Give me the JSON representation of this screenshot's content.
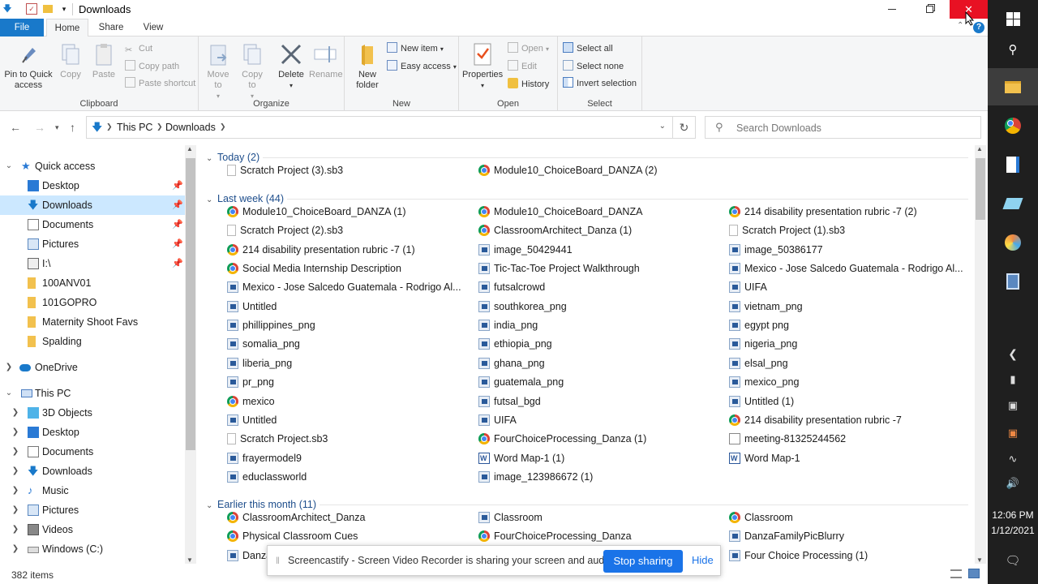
{
  "window": {
    "title": "Downloads",
    "help_label": "?"
  },
  "tabs": [
    "File",
    "Home",
    "Share",
    "View"
  ],
  "ribbon": {
    "clipboard": {
      "label": "Clipboard",
      "pin": "Pin to Quick access",
      "copy": "Copy",
      "paste": "Paste",
      "cut": "Cut",
      "copy_path": "Copy path",
      "paste_shortcut": "Paste shortcut"
    },
    "organize": {
      "label": "Organize",
      "move_to": "Move to",
      "copy_to": "Copy to",
      "delete": "Delete",
      "rename": "Rename"
    },
    "new": {
      "label": "New",
      "new_folder": "New folder",
      "new_item": "New item",
      "easy_access": "Easy access"
    },
    "open": {
      "label": "Open",
      "properties": "Properties",
      "open": "Open",
      "edit": "Edit",
      "history": "History"
    },
    "select": {
      "label": "Select",
      "select_all": "Select all",
      "select_none": "Select none",
      "invert": "Invert selection"
    }
  },
  "address": {
    "this_pc": "This PC",
    "downloads": "Downloads",
    "search_placeholder": "Search Downloads"
  },
  "nav": {
    "quick_access": "Quick access",
    "qa_items": [
      {
        "label": "Desktop"
      },
      {
        "label": "Downloads"
      },
      {
        "label": "Documents"
      },
      {
        "label": "Pictures"
      },
      {
        "label": "I:\\"
      },
      {
        "label": "100ANV01"
      },
      {
        "label": "101GOPRO"
      },
      {
        "label": "Maternity Shoot Favs"
      },
      {
        "label": "Spalding"
      }
    ],
    "onedrive": "OneDrive",
    "this_pc": "This PC",
    "pc_items": [
      {
        "label": "3D Objects"
      },
      {
        "label": "Desktop"
      },
      {
        "label": "Documents"
      },
      {
        "label": "Downloads"
      },
      {
        "label": "Music"
      },
      {
        "label": "Pictures"
      },
      {
        "label": "Videos"
      },
      {
        "label": "Windows (C:)"
      }
    ]
  },
  "groups": [
    {
      "header": "Today (2)",
      "files": [
        {
          "name": "Scratch Project (3).sb3",
          "icon": "blank-file"
        },
        {
          "name": "Module10_ChoiceBoard_DANZA (2)",
          "icon": "chrome"
        }
      ]
    },
    {
      "header": "Last week (44)",
      "files": [
        {
          "name": "Module10_ChoiceBoard_DANZA (1)",
          "icon": "chrome"
        },
        {
          "name": "Module10_ChoiceBoard_DANZA",
          "icon": "chrome"
        },
        {
          "name": "214 disability presentation rubric -7 (2)",
          "icon": "chrome"
        },
        {
          "name": "Scratch Project (2).sb3",
          "icon": "blank-file"
        },
        {
          "name": "ClassroomArchitect_Danza (1)",
          "icon": "chrome"
        },
        {
          "name": "Scratch Project (1).sb3",
          "icon": "blank-file"
        },
        {
          "name": "214 disability presentation rubric -7 (1)",
          "icon": "chrome"
        },
        {
          "name": "image_50429441",
          "icon": "image"
        },
        {
          "name": "image_50386177",
          "icon": "image"
        },
        {
          "name": "Social Media Internship Description",
          "icon": "chrome"
        },
        {
          "name": "Tic-Tac-Toe Project Walkthrough",
          "icon": "image"
        },
        {
          "name": "Mexico - Jose Salcedo Guatemala - Rodrigo Al...",
          "icon": "image"
        },
        {
          "name": "Mexico - Jose Salcedo Guatemala - Rodrigo Al...",
          "icon": "image"
        },
        {
          "name": "futsalcrowd",
          "icon": "image"
        },
        {
          "name": "UIFA",
          "icon": "image"
        },
        {
          "name": "Untitled",
          "icon": "image"
        },
        {
          "name": "southkorea_png",
          "icon": "image"
        },
        {
          "name": "vietnam_png",
          "icon": "image"
        },
        {
          "name": "phillippines_png",
          "icon": "image"
        },
        {
          "name": "india_png",
          "icon": "image"
        },
        {
          "name": "egypt png",
          "icon": "image"
        },
        {
          "name": "somalia_png",
          "icon": "image"
        },
        {
          "name": "ethiopia_png",
          "icon": "image"
        },
        {
          "name": "nigeria_png",
          "icon": "image"
        },
        {
          "name": "liberia_png",
          "icon": "image"
        },
        {
          "name": "ghana_png",
          "icon": "image"
        },
        {
          "name": "elsal_png",
          "icon": "image"
        },
        {
          "name": "pr_png",
          "icon": "image"
        },
        {
          "name": "guatemala_png",
          "icon": "image"
        },
        {
          "name": "mexico_png",
          "icon": "image"
        },
        {
          "name": "mexico",
          "icon": "chrome"
        },
        {
          "name": "futsal_bgd",
          "icon": "image"
        },
        {
          "name": "Untitled (1)",
          "icon": "image"
        },
        {
          "name": "Untitled",
          "icon": "image"
        },
        {
          "name": "UIFA",
          "icon": "image"
        },
        {
          "name": "214 disability presentation rubric -7",
          "icon": "chrome"
        },
        {
          "name": "Scratch Project.sb3",
          "icon": "blank-file"
        },
        {
          "name": "FourChoiceProcessing_Danza (1)",
          "icon": "chrome"
        },
        {
          "name": "meeting-81325244562",
          "icon": "meeting"
        },
        {
          "name": "frayermodel9",
          "icon": "image"
        },
        {
          "name": "Word Map-1 (1)",
          "icon": "word"
        },
        {
          "name": "Word Map-1",
          "icon": "word"
        },
        {
          "name": "educlassworld",
          "icon": "image"
        },
        {
          "name": "image_123986672 (1)",
          "icon": "image"
        }
      ]
    },
    {
      "header": "Earlier this month (11)",
      "files": [
        {
          "name": "ClassroomArchitect_Danza",
          "icon": "chrome"
        },
        {
          "name": "Classroom",
          "icon": "image"
        },
        {
          "name": "Classroom",
          "icon": "chrome"
        },
        {
          "name": "Physical Classroom Cues",
          "icon": "chrome"
        },
        {
          "name": "FourChoiceProcessing_Danza",
          "icon": "chrome"
        },
        {
          "name": "DanzaFamilyPicBlurry",
          "icon": "image"
        },
        {
          "name": "Danza",
          "icon": "image"
        },
        {
          "name": "",
          "icon": "image"
        },
        {
          "name": "Four Choice Processing (1)",
          "icon": "image"
        }
      ]
    }
  ],
  "status": {
    "items": "382 items"
  },
  "notice": {
    "text": "Screencastify - Screen Video Recorder is sharing your screen and audio.",
    "stop": "Stop sharing",
    "hide": "Hide"
  },
  "clock": {
    "time": "12:06 PM",
    "date": "1/12/2021"
  },
  "colors": {
    "accent": "#1979ca",
    "close": "#e81123",
    "selection": "#cce8ff",
    "group_header": "#1e4e8c",
    "taskbar": "#1f1f1f",
    "stop_button": "#1a73e8"
  }
}
